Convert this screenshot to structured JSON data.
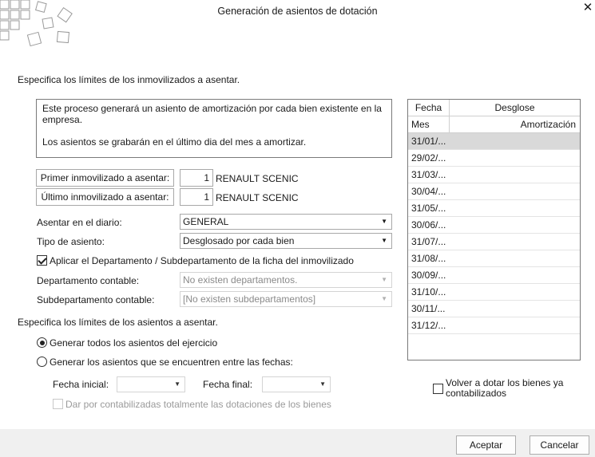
{
  "window": {
    "title": "Generación de asientos de dotación",
    "close_glyph": "✕"
  },
  "section1": {
    "heading": "Especifica los límites de los inmovilizados a asentar."
  },
  "info": {
    "line1": "Este proceso generará un asiento de amortización por cada bien existente en la empresa.",
    "line2": "Los asientos se grabarán en el último dia del mes a amortizar."
  },
  "first_asset": {
    "button_label": "Primer inmovilizado a asentar:",
    "number": "1",
    "name": "RENAULT SCENIC"
  },
  "last_asset": {
    "button_label": "Último inmovilizado a asentar:",
    "number": "1",
    "name": "RENAULT SCENIC"
  },
  "diario": {
    "label": "Asentar en el diario:",
    "value": "GENERAL"
  },
  "tipo": {
    "label": "Tipo de asiento:",
    "value": "Desglosado por cada bien"
  },
  "aplicar_dept": {
    "label": "Aplicar el Departamento / Subdepartamento de la ficha del inmovilizado",
    "checked": true
  },
  "departamento": {
    "label": "Departamento contable:",
    "value": "No existen departamentos."
  },
  "subdepartamento": {
    "label": "Subdepartamento contable:",
    "value": "[No existen subdepartamentos]"
  },
  "section2": {
    "heading": "Especifica los límites de los asientos a asentar."
  },
  "radio_all": {
    "label": "Generar todos los asientos del ejercicio",
    "selected": true
  },
  "radio_range": {
    "label": "Generar los asientos que se encuentren entre las fechas:",
    "selected": false
  },
  "fecha_inicial": {
    "label": "Fecha inicial:",
    "value": ""
  },
  "fecha_final": {
    "label": "Fecha final:",
    "value": ""
  },
  "dar_contabilizadas": {
    "label": "Dar por contabilizadas totalmente las dotaciones de los bienes",
    "checked": false
  },
  "grid": {
    "header_fecha": "Fecha",
    "header_desglose": "Desglose",
    "header_mes": "Mes",
    "header_amortizacion": "Amortización",
    "rows": [
      "31/01/...",
      "29/02/...",
      "31/03/...",
      "30/04/...",
      "31/05/...",
      "30/06/...",
      "31/07/...",
      "31/08/...",
      "30/09/...",
      "31/10/...",
      "30/11/...",
      "31/12/..."
    ]
  },
  "volver_dotar": {
    "label": "Volver a dotar los bienes ya contabilizados",
    "checked": false
  },
  "footer": {
    "accept_label": "Aceptar",
    "cancel_label": "Cancelar"
  }
}
